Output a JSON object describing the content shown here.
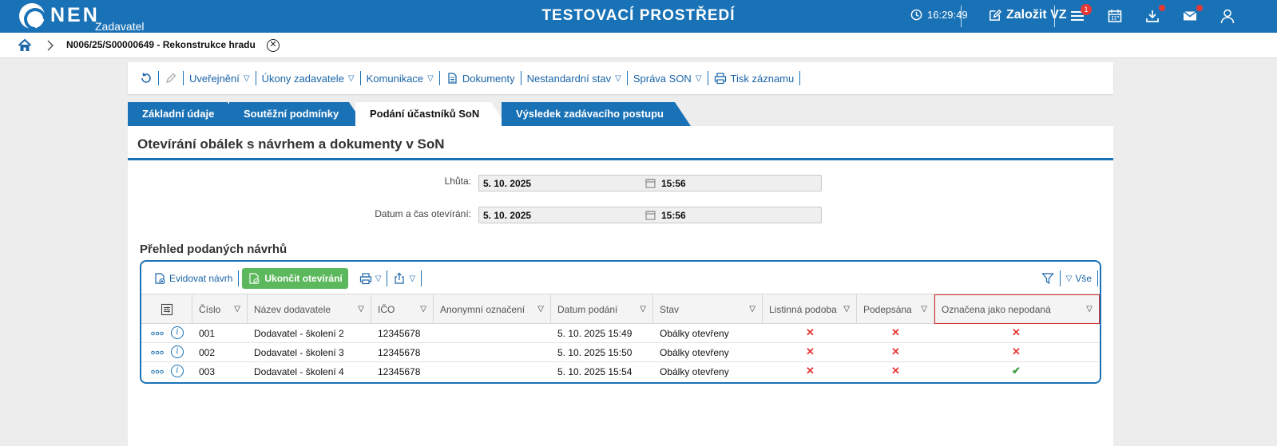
{
  "topbar": {
    "logo": "NEN",
    "logo_sub": "Zadavatel",
    "env_title": "TESTOVACÍ PROSTŘEDÍ",
    "time": "16:29:49",
    "create_label": "Založit VZ",
    "menu_badge": "1",
    "icons": [
      "clock-icon",
      "edit-icon",
      "menu-icon",
      "calendar-icon",
      "download-icon",
      "mail-icon",
      "user-icon"
    ],
    "accent": "#1a72b6"
  },
  "breadcrumb": {
    "current": "N006/25/S00000649 - Rekonstrukce hradu"
  },
  "toolbar": {
    "items": [
      {
        "label": "Uveřejnění"
      },
      {
        "label": "Úkony zadavatele"
      },
      {
        "label": "Komunikace"
      },
      {
        "label": "Dokumenty"
      },
      {
        "label": "Nestandardní stav"
      },
      {
        "label": "Správa SON"
      },
      {
        "label": "Tisk záznamu"
      }
    ]
  },
  "tabs": [
    {
      "label": "Základní údaje",
      "active": false
    },
    {
      "label": "Soutěžní podmínky",
      "active": false
    },
    {
      "label": "Podání účastníků SoN",
      "active": true
    },
    {
      "label": "Výsledek zadávacího postupu",
      "active": false
    }
  ],
  "section": {
    "title": "Otevírání obálek s návrhem a dokumenty v SoN",
    "deadline_label": "Lhůta:",
    "deadline_date": "5. 10. 2025",
    "deadline_time": "15:56",
    "opening_label": "Datum a čas otevírání:",
    "opening_date": "5. 10. 2025",
    "opening_time": "15:56"
  },
  "grid": {
    "title": "Přehled podaných návrhů",
    "register_label": "Evidovat návrh",
    "finish_label": "Ukončit otevírání",
    "filter_all_label": "Vše",
    "columns": [
      "Číslo",
      "Název dodavatele",
      "IČO",
      "Anonymní označení",
      "Datum podání",
      "Stav",
      "Listinná podoba",
      "Podepsána",
      "Označena jako nepodaná"
    ],
    "rows": [
      {
        "cislo": "001",
        "nazev": "Dodavatel - školení 2",
        "ico": "12345678",
        "anonym": "",
        "datum": "5. 10. 2025 15:49",
        "stav": "Obálky otevřeny",
        "listinna": "✕",
        "podepsana": "✕",
        "nepodana": "✕",
        "nepodana_ok": false
      },
      {
        "cislo": "002",
        "nazev": "Dodavatel - školení 3",
        "ico": "12345678",
        "anonym": "",
        "datum": "5. 10. 2025 15:50",
        "stav": "Obálky otevřeny",
        "listinna": "✕",
        "podepsana": "✕",
        "nepodana": "✕",
        "nepodana_ok": false
      },
      {
        "cislo": "003",
        "nazev": "Dodavatel - školení 4",
        "ico": "12345678",
        "anonym": "",
        "datum": "5. 10. 2025 15:54",
        "stav": "Obálky otevřeny",
        "listinna": "✕",
        "podepsana": "✕",
        "nepodana": "✔",
        "nepodana_ok": true
      }
    ]
  }
}
